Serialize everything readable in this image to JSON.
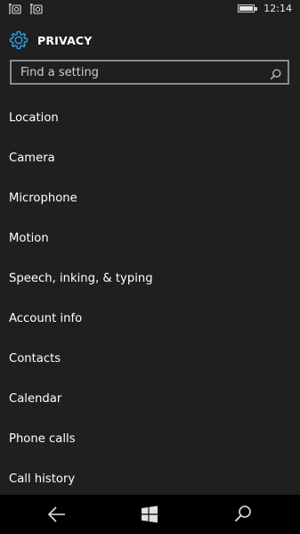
{
  "status_bar": {
    "time": "12:14",
    "icons": [
      "notification-sync-icon",
      "notification-sync-icon",
      "battery-icon"
    ]
  },
  "header": {
    "icon": "gear-icon",
    "title": "PRIVACY",
    "accent_color": "#2b9ad6"
  },
  "search": {
    "placeholder": "Find a setting",
    "value": "",
    "icon": "search-icon"
  },
  "items": [
    {
      "label": "Location"
    },
    {
      "label": "Camera"
    },
    {
      "label": "Microphone"
    },
    {
      "label": "Motion"
    },
    {
      "label": "Speech, inking, & typing"
    },
    {
      "label": "Account info"
    },
    {
      "label": "Contacts"
    },
    {
      "label": "Calendar"
    },
    {
      "label": "Phone calls"
    },
    {
      "label": "Call history"
    }
  ],
  "nav_bar": {
    "buttons": [
      "back-arrow-icon",
      "windows-logo-icon",
      "search-icon"
    ]
  },
  "colors": {
    "background": "#1f1f1f",
    "nav_background": "#000000",
    "text": "#ffffff",
    "search_border": "#8a8a8a"
  }
}
